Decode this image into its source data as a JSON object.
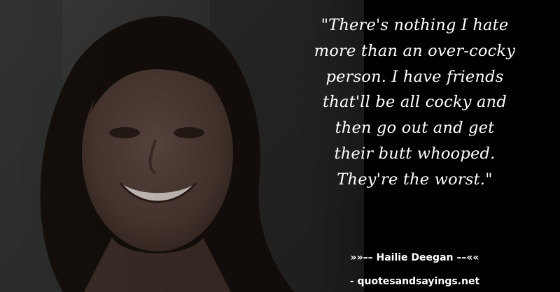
{
  "quote": {
    "lines": [
      "\"There's nothing I hate",
      "more than an over-cocky",
      "person. I have friends",
      "that'll be all cocky and",
      "then go out and get",
      "their butt whooped.",
      "They're the worst.\""
    ]
  },
  "attribution": {
    "prefix": "»»–– ",
    "author": "Hailie Deegan",
    "suffix": " ––««"
  },
  "source": {
    "text": "- quotesandsayings.net"
  },
  "colors": {
    "background": "#000000",
    "text": "#ffffff"
  }
}
